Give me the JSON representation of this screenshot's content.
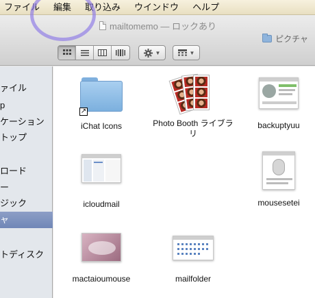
{
  "menubar": {
    "items": [
      "ファイル",
      "編集",
      "取り込み",
      "ウインドウ",
      "ヘルプ"
    ]
  },
  "window": {
    "title": "mailtomemo — ロックあり",
    "location": "ピクチャ"
  },
  "toolbar": {
    "view_modes": [
      "icon-view-icon",
      "list-view-icon",
      "column-view-icon",
      "coverflow-view-icon"
    ],
    "active_view": "icon",
    "action_icon": "gear-icon",
    "arrange_icon": "arrange-icon"
  },
  "sidebar": {
    "items": [
      {
        "label": "ァイル"
      },
      {
        "label": "p"
      },
      {
        "label": "ケーション"
      },
      {
        "label": "トップ"
      },
      {
        "label": "ロード"
      },
      {
        "label": "ー"
      },
      {
        "label": "ジック"
      },
      {
        "label": "ャ"
      },
      {
        "label": "トディスク"
      }
    ],
    "selected_index": 7
  },
  "files": [
    {
      "name": "iChat Icons",
      "kind": "folder-alias"
    },
    {
      "name": "Photo Booth ライブラリ",
      "kind": "photobooth-library"
    },
    {
      "name": "backuptyuu",
      "kind": "screenshot"
    },
    {
      "name": "icloudmail",
      "kind": "screenshot"
    },
    {
      "name": "mousesetei",
      "kind": "screenshot"
    },
    {
      "name": "mactaioumouse",
      "kind": "image"
    },
    {
      "name": "mailfolder",
      "kind": "screenshot"
    }
  ],
  "colors": {
    "menubar": "#efe7cc",
    "sidebar_selected": "#7f93bf",
    "highlight_circle": "#8c78e6"
  }
}
